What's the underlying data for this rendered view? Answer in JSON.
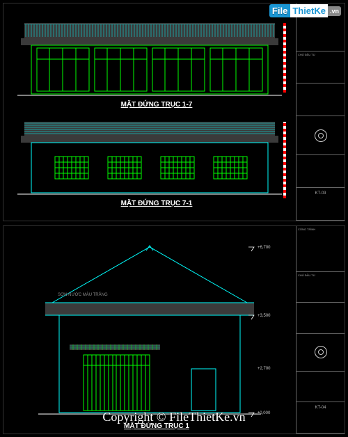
{
  "watermark": {
    "file": "File",
    "thietke": "ThietKe",
    "tld": ".vn"
  },
  "copyright": "Copyright © FileThietKe.vn",
  "sheets": {
    "top": {
      "elevations": [
        {
          "label": "MẶT ĐỨNG TRỤC 1-7"
        },
        {
          "label": "MẶT ĐỨNG TRỤC 7-1"
        }
      ]
    },
    "bottom": {
      "elevations": [
        {
          "label": "MẶT ĐỨNG TRỤC 1"
        }
      ]
    }
  },
  "dims": {
    "top_ridge": "+6,700",
    "mid": "+3,500",
    "ground": "±0,000"
  },
  "title_block": {
    "project": "CÔNG TRÌNH",
    "owner": "CHỦ ĐẦU TƯ",
    "sheet_top": "KT-03",
    "sheet_bottom": "KT-04"
  }
}
